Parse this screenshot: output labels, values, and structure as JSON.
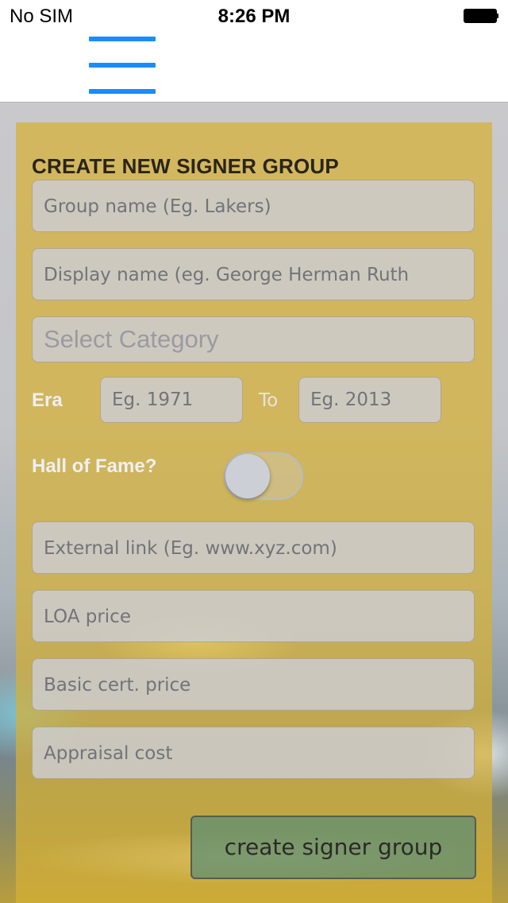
{
  "status_bar": {
    "carrier": "No SIM",
    "time": "8:26 PM"
  },
  "nav": {
    "menu_icon": "hamburger-menu-icon",
    "accent_color": "#1a8cff"
  },
  "form": {
    "title": "CREATE NEW SIGNER GROUP",
    "group_name_placeholder": "Group name (Eg. Lakers)",
    "display_name_placeholder": "Display name (eg. George Herman Ruth",
    "category_placeholder": "Select Category",
    "era_label": "Era",
    "era_from_placeholder": "Eg. 1971",
    "era_to_label": "To",
    "era_to_placeholder": "Eg. 2013",
    "hall_of_fame_label": "Hall of Fame?",
    "hall_of_fame_on": false,
    "external_link_placeholder": "External link (Eg. www.xyz.com)",
    "loa_price_placeholder": "LOA price",
    "basic_cert_price_placeholder": "Basic cert. price",
    "appraisal_cost_placeholder": "Appraisal cost",
    "submit_label": "create signer group"
  }
}
